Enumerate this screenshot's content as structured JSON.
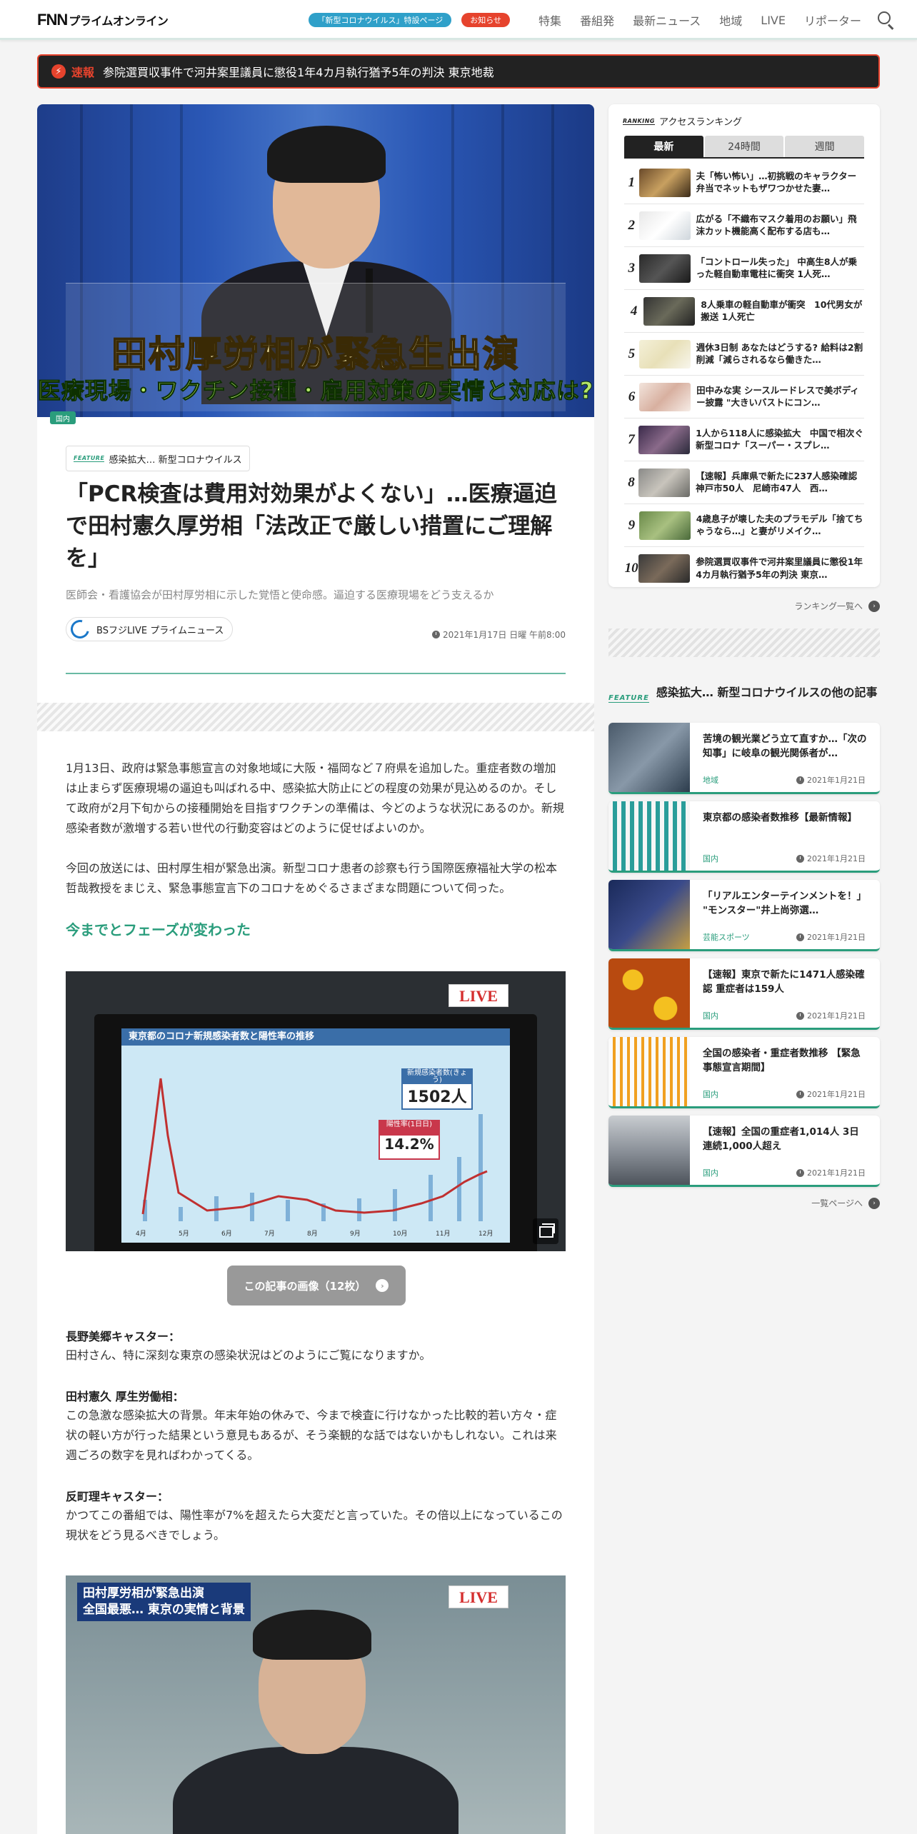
{
  "header": {
    "logo_fnn": "FNN",
    "logo_sub": "プライムオンライン",
    "covid_special": "「新型コロナウイルス」特設ページ",
    "notice": "お知らせ",
    "nav": [
      "特集",
      "番組発",
      "最新ニュース",
      "地域",
      "LIVE",
      "リポーター"
    ]
  },
  "breaking": {
    "label": "速報",
    "text": "参院選買収事件で河井案里議員に懲役1年4カ月執行猶予5年の判決 東京地裁"
  },
  "article": {
    "hero_caption_main": "田村厚労相が緊急生出演",
    "hero_caption_sub": "医療現場・ワクチン接種・雇用対策の実情と対応は?",
    "category": "国内",
    "feature_mark": "FEATURE",
    "feature_name": "感染拡大… 新型コロナウイルス",
    "title": "「PCR検査は費用対効果がよくない」…医療逼迫で田村憲久厚労相「法改正で厳しい措置にご理解を」",
    "subtitle": "医師会・看護協会が田村厚労相に示した覚悟と使命感。逼迫する医療現場をどう支えるか",
    "source": "BSフジLIVE プライムニュース",
    "datetime": "2021年1月17日 日曜 午前8:00",
    "para1": "1月13日、政府は緊急事態宣言の対象地域に大阪・福岡など７府県を追加した。重症者数の増加は止まらず医療現場の逼迫も叫ばれる中、感染拡大防止にどの程度の効果が見込めるのか。そして政府が2月下旬からの接種開始を目指すワクチンの準備は、今どのような状況にあるのか。新規感染者数が激増する若い世代の行動変容はどのように促せばよいのか。",
    "para2": "今回の放送には、田村厚生相が緊急出演。新型コロナ患者の診察も行う国際医療福祉大学の松本哲哉教授をまじえ、緊急事態宣言下のコロナをめぐるさまざまな問題について伺った。",
    "section_heading": "今までとフェーズが変わった",
    "image1": {
      "live": "LIVE",
      "chart_title": "東京都のコロナ新規感染者数と陽性率の推移",
      "new_cases_label": "新規感染者数(きょう)",
      "new_cases_value": "1502人",
      "positivity_label": "陽性率(1日日)",
      "positivity_value": "14.2%"
    },
    "gallery_button": "この記事の画像（12枚）",
    "speaker1": "長野美郷キャスター：",
    "speaker1_text": "田村さん、特に深刻な東京の感染状況はどのようにご覧になりますか。",
    "speaker2": "田村憲久 厚生労働相：",
    "speaker2_text": "この急激な感染拡大の背景。年末年始の休みで、今まで検査に行けなかった比較的若い方々・症状の軽い方が行った結果という意見もあるが、そう楽観的な話ではないかもしれない。これは来週ごろの数字を見ればわかってくる。",
    "speaker3": "反町理キャスター：",
    "speaker3_text": "かつてこの番組では、陽性率が7%を超えたら大変だと言っていた。その倍以上になっているこの現状をどう見るべきでしょう。",
    "image2": {
      "caption_line1": "田村厚労相が緊急出演",
      "caption_line2": "全国最悪… 東京の実情と背景",
      "live": "LIVE"
    }
  },
  "ranking": {
    "mark": "RANKING",
    "title": "アクセスランキング",
    "tabs": [
      "最新",
      "24時間",
      "週間"
    ],
    "items": [
      {
        "rank": "1",
        "title": "夫「怖い怖い」…初挑戦のキャラクター弁当でネットもザワつかせた妻…"
      },
      {
        "rank": "2",
        "title": "広がる「不織布マスク着用のお願い」飛沫カット機能高く配布する店も…"
      },
      {
        "rank": "3",
        "title": "「コントロール失った」 中高生8人が乗った軽自動車電柱に衝突 1人死…"
      },
      {
        "rank": "4",
        "title": "8人乗車の軽自動車が衝突　10代男女が搬送 1人死亡"
      },
      {
        "rank": "5",
        "title": "週休3日制 あなたはどうする? 給料は2割削減「減らされるなら働きた…"
      },
      {
        "rank": "6",
        "title": "田中みな実 シースルードレスで美ボディー披露 \"大きいバストにコン…"
      },
      {
        "rank": "7",
        "title": "1人から118人に感染拡大　中国で相次ぐ新型コロナ「スーパー・スプレ…"
      },
      {
        "rank": "8",
        "title": "【速報】兵庫県で新たに237人感染確認　神戸市50人　尼崎市47人　西…"
      },
      {
        "rank": "9",
        "title": "4歳息子が壊した夫のプラモデル「捨てちゃうなら…」と妻がリメイク…"
      },
      {
        "rank": "10",
        "title": "参院選買収事件で河井案里議員に懲役1年4カ月執行猶予5年の判決 東京…"
      }
    ],
    "more": "ランキング一覧へ"
  },
  "feature_list": {
    "mark": "FEATURE",
    "title": "感染拡大… 新型コロナウイルスの他の記事",
    "items": [
      {
        "title": "苦境の観光業どう立て直すか…「次の知事」に岐阜の観光関係者が…",
        "category": "地域",
        "date": "2021年1月21日"
      },
      {
        "title": "東京都の感染者数推移【最新情報】",
        "category": "国内",
        "date": "2021年1月21日"
      },
      {
        "title": "「リアルエンターテインメントを！」 \"モンスター\"井上尚弥選…",
        "category": "芸能スポーツ",
        "date": "2021年1月21日"
      },
      {
        "title": "【速報】東京で新たに1471人感染確認 重症者は159人",
        "category": "国内",
        "date": "2021年1月21日"
      },
      {
        "title": "全国の感染者・重症者数推移 【緊急事態宣言期間】",
        "category": "国内",
        "date": "2021年1月21日"
      },
      {
        "title": "【速報】全国の重症者1,014人 3日連続1,000人超え",
        "category": "国内",
        "date": "2021年1月21日"
      }
    ],
    "more": "一覧ページへ"
  }
}
